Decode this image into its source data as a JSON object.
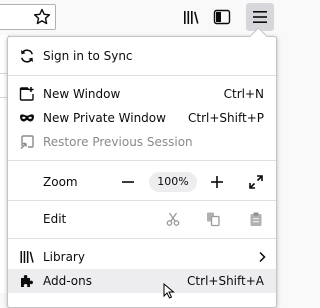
{
  "toolbar": {
    "icons": [
      "bookmark-star-icon",
      "library-icon",
      "sidebar-icon",
      "hamburger-menu-icon"
    ]
  },
  "menu": {
    "sync_label": "Sign in to Sync",
    "new_window": {
      "label": "New Window",
      "shortcut": "Ctrl+N"
    },
    "new_private_window": {
      "label": "New Private Window",
      "shortcut": "Ctrl+Shift+P"
    },
    "restore_session": {
      "label": "Restore Previous Session"
    },
    "zoom": {
      "label": "Zoom",
      "minus": "−",
      "value": "100%",
      "plus": "+"
    },
    "edit": {
      "label": "Edit"
    },
    "library": {
      "label": "Library"
    },
    "addons": {
      "label": "Add-ons",
      "shortcut": "Ctrl+Shift+A"
    }
  },
  "colors": {
    "hover": "#ededf0",
    "disabled": "#8a8a8d",
    "panel_border": "#c4c4c6"
  }
}
